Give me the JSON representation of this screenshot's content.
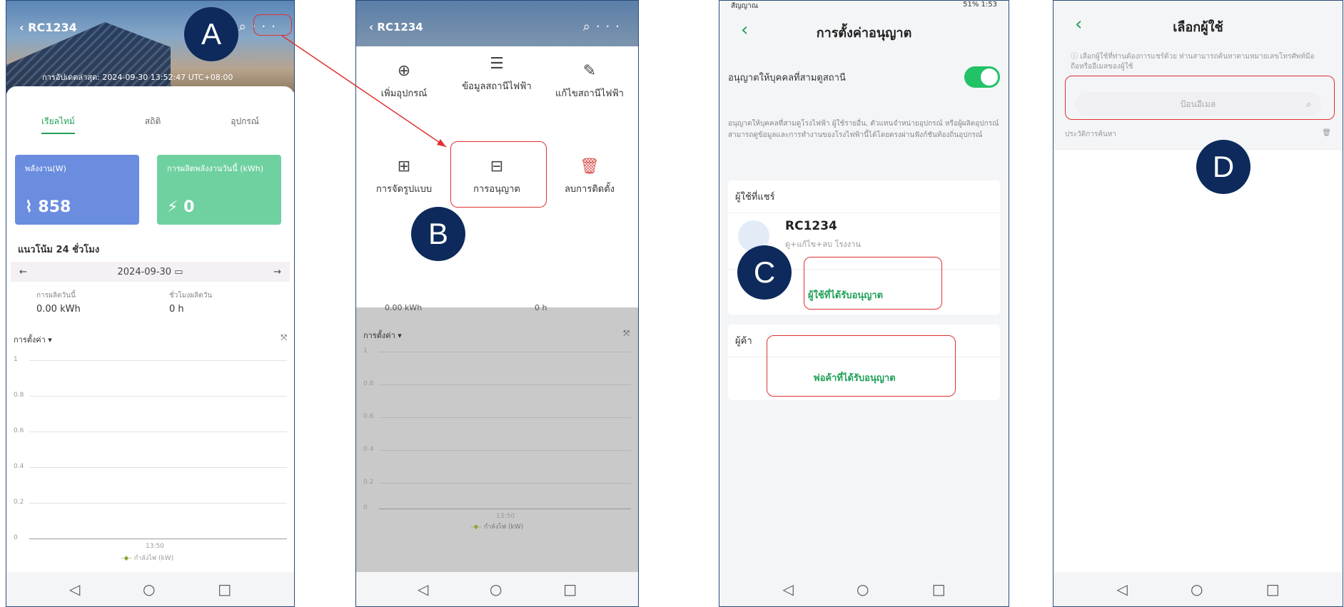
{
  "callouts": {
    "a": "A",
    "b": "B",
    "c": "C",
    "d": "D"
  },
  "phone1": {
    "title": "RC1234",
    "updated": "การอัปเดตล่าสุด: 2024-09-30 13:52:47 UTC+08:00",
    "tabs": [
      "เรียลไทม์",
      "สถิติ",
      "อุปกรณ์"
    ],
    "kpi_power_label": "พลังงาน(W)",
    "kpi_power_value": "858",
    "kpi_today_label": "การผลิตพลังงานวันนี้ (kWh)",
    "kpi_today_value": "0",
    "trend_title": "แนวโน้ม 24 ชั่วโมง",
    "date": "2024-09-30",
    "stat1_label": "การผลิตวันนี้",
    "stat1_value": "0.00 kWh",
    "stat2_label": "ชั่วโมงผลิตวัน",
    "stat2_value": "0 h",
    "chart_label": "การตั้งค่า",
    "y_ticks": [
      "1",
      "0.8",
      "0.6",
      "0.4",
      "0.2",
      "0"
    ],
    "x_tick": "13:50",
    "legend": "กำลังไฟ (kW)"
  },
  "phone2": {
    "title": "RC1234",
    "menu": {
      "add_device": "เพิ่มอุปกรณ์",
      "station_info": "ข้อมูลสถานีไฟฟ้า",
      "edit_station": "แก้ไขสถานีไฟฟ้า",
      "layout": "การจัดรูปแบบ",
      "permission": "การอนุญาต",
      "delete_install": "ลบการติดตั้ง"
    },
    "stat_values": "0.00 kWh",
    "stat_value2": "0 h",
    "chart_label": "การตั้งค่า",
    "y_ticks": [
      "1",
      "0.8",
      "0.6",
      "0.4",
      "0.2",
      "0"
    ],
    "x_tick": "13:50",
    "legend": "กำลังไฟ (kW)"
  },
  "phone3": {
    "status_left": "สัญญาณ",
    "status_right": "51% 1:53",
    "title": "การตั้งค่าอนุญาต",
    "toggle_label": "อนุญาตให้บุคคลที่สามดูสถานี",
    "description": "อนุญาตให้บุคคลที่สามดูโรงไฟฟ้า ผู้ใช้รายอื่น, ตัวแทนจำหน่ายอุปกรณ์ หรือผู้ผลิตอุปกรณ์สามารถดูข้อมูลและการทำงานของโรงไฟฟ้านี้ได้โดยตรงผ่านฟังก์ชันท้องถิ่นอุปกรณ์",
    "shared_users": "ผู้ใช้ที่แชร์",
    "user_name": "RC1234",
    "user_role": "ดู+แก้ไข+ลบ โรงงาน",
    "authorized_users": "ผู้ใช้ที่ได้รับอนุญาต",
    "dealers": "ผู้ค้า",
    "authorized_dealers": "พ่อค้าที่ได้รับอนุญาต"
  },
  "phone4": {
    "title": "เลือกผู้ใช้",
    "info": "เลือกผู้ใช้ที่ท่านต้องการแชร์ด้วย ท่านสามารถค้นหาตามหมายเลขโทรศัพท์มือถือหรืออีเมลของผู้ใช้",
    "search_placeholder": "ป้อนอีเมล",
    "history": "ประวัติการค้นหา"
  },
  "colors": {
    "accent": "#22a05a",
    "callout": "#0e2a5c",
    "highlight": "#e03131"
  }
}
